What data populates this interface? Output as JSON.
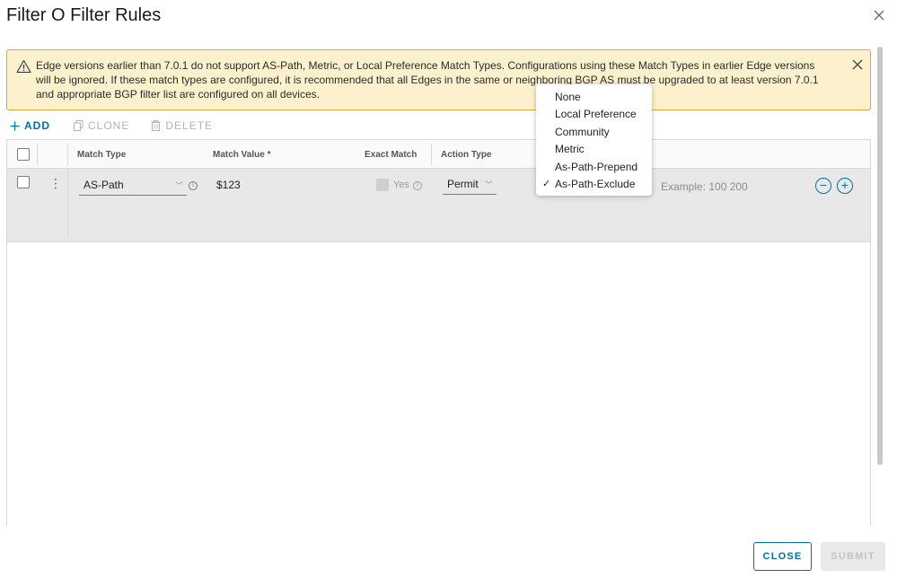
{
  "dialog": {
    "title": "Filter O Filter Rules",
    "close_icon": "close-icon"
  },
  "alert": {
    "icon": "warning-icon",
    "message": "Edge versions earlier than 7.0.1 do not support AS-Path, Metric, or Local Preference Match Types. Configurations using these Match Types in earlier Edge versions will be ignored. If these match types are configured, it is recommended that all Edges in the same or neighboring BGP AS must be upgraded to at least version 7.0.1 and appropriate BGP filter list are configured on all devices."
  },
  "toolbar": {
    "add_label": "ADD",
    "clone_label": "CLONE",
    "delete_label": "DELETE"
  },
  "grid": {
    "columns": [
      "Match Type",
      "Match Value *",
      "Exact Match",
      "Action Type"
    ],
    "rows": [
      {
        "match_type": "AS-Path",
        "match_value": "$123",
        "exact_match_label": "Yes",
        "action_type": "Permit",
        "example": "Example: 100 200"
      }
    ]
  },
  "dropdown": {
    "options": [
      "None",
      "Local Preference",
      "Community",
      "Metric",
      "As-Path-Prepend",
      "As-Path-Exclude"
    ],
    "selected": "As-Path-Exclude",
    "check_glyph": "✓"
  },
  "footer": {
    "close_label": "CLOSE",
    "submit_label": "SUBMIT"
  },
  "colors": {
    "accent": "#0072a3",
    "alert_bg": "#fdf1cd",
    "alert_border": "#e6a23c"
  }
}
